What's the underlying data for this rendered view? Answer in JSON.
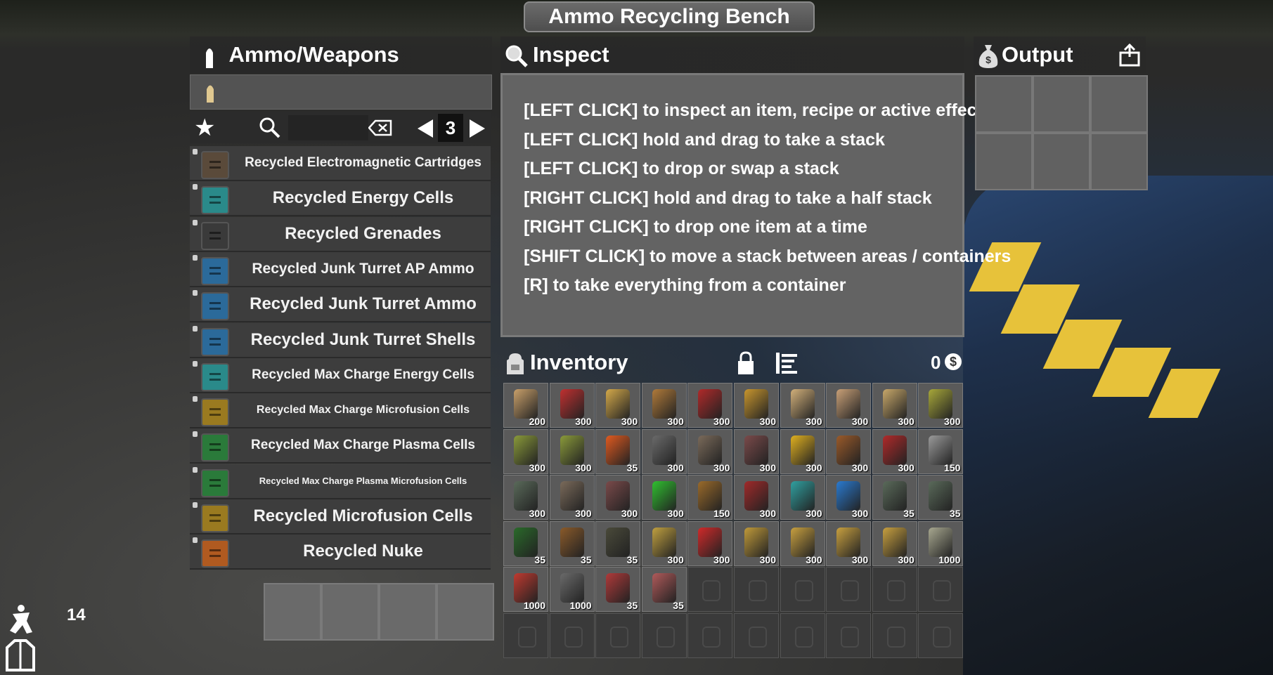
{
  "window_title": "Ammo Recycling Bench",
  "left_panel": {
    "title": "Ammo/Weapons",
    "page": "3",
    "recipes": [
      {
        "label": "Recycled Electromagnetic Cartridges",
        "color": "#5a4a3a",
        "size": 19
      },
      {
        "label": "Recycled Energy Cells",
        "color": "#2a8a8a",
        "size": 24
      },
      {
        "label": "Recycled Grenades",
        "color": "#3a3a3a",
        "size": 24
      },
      {
        "label": "Recycled Junk Turret AP Ammo",
        "color": "#2b6a9a",
        "size": 21
      },
      {
        "label": "Recycled Junk Turret Ammo",
        "color": "#2b6a9a",
        "size": 24
      },
      {
        "label": "Recycled Junk Turret Shells",
        "color": "#2b6a9a",
        "size": 24
      },
      {
        "label": "Recycled Max Charge Energy Cells",
        "color": "#2a8a8a",
        "size": 19
      },
      {
        "label": "Recycled Max Charge Microfusion Cells",
        "color": "#9a7a20",
        "size": 16
      },
      {
        "label": "Recycled Max Charge Plasma Cells",
        "color": "#2a7a3a",
        "size": 19
      },
      {
        "label": "Recycled Max Charge Plasma Microfusion Cells",
        "color": "#2a7a3a",
        "size": 13
      },
      {
        "label": "Recycled Microfusion Cells",
        "color": "#9a7a20",
        "size": 24
      },
      {
        "label": "Recycled Nuke",
        "color": "#b05a20",
        "size": 24
      }
    ]
  },
  "inspect": {
    "title": "Inspect",
    "lines": [
      "[LEFT CLICK] to inspect an item, recipe or active effect",
      "[LEFT CLICK] hold and drag to take a stack",
      "[LEFT CLICK] to drop or swap a stack",
      "[RIGHT CLICK] hold and drag to take a half stack",
      "[RIGHT CLICK] to drop one item at a time",
      "[SHIFT CLICK] to move a stack between areas / containers",
      "[R] to take everything from a container"
    ]
  },
  "output": {
    "title": "Output"
  },
  "inventory": {
    "title": "Inventory",
    "money": "0",
    "rows": [
      [
        {
          "c": "200",
          "col": "#c9a06a"
        },
        {
          "c": "300",
          "col": "#c03030"
        },
        {
          "c": "300",
          "col": "#d4a94a"
        },
        {
          "c": "300",
          "col": "#b07a3a"
        },
        {
          "c": "300",
          "col": "#b02a2a"
        },
        {
          "c": "300",
          "col": "#c8962e"
        },
        {
          "c": "300",
          "col": "#d2b07a"
        },
        {
          "c": "300",
          "col": "#c9a077"
        },
        {
          "c": "300",
          "col": "#c8a86a"
        },
        {
          "c": "300",
          "col": "#a8a83a"
        }
      ],
      [
        {
          "c": "300",
          "col": "#8a9a3a"
        },
        {
          "c": "300",
          "col": "#8a9a3a"
        },
        {
          "c": "35",
          "col": "#e05a20"
        },
        {
          "c": "300",
          "col": "#6a6a6a"
        },
        {
          "c": "300",
          "col": "#7a6a5a"
        },
        {
          "c": "300",
          "col": "#7a4a4a"
        },
        {
          "c": "300",
          "col": "#e0b020"
        },
        {
          "c": "300",
          "col": "#9a5a2a"
        },
        {
          "c": "300",
          "col": "#b02a2a"
        },
        {
          "c": "150",
          "col": "#9a9a9a"
        }
      ],
      [
        {
          "c": "300",
          "col": "#5a6a5a"
        },
        {
          "c": "300",
          "col": "#7a6a5a"
        },
        {
          "c": "300",
          "col": "#7a4a4a"
        },
        {
          "c": "300",
          "col": "#30c030"
        },
        {
          "c": "150",
          "col": "#9a6a2a"
        },
        {
          "c": "300",
          "col": "#a02a2a"
        },
        {
          "c": "300",
          "col": "#30a0a0"
        },
        {
          "c": "300",
          "col": "#2a7ad0"
        },
        {
          "c": "35",
          "col": "#5a6a5a"
        },
        {
          "c": "35",
          "col": "#5a6a5a"
        }
      ],
      [
        {
          "c": "35",
          "col": "#2a6a2a"
        },
        {
          "c": "35",
          "col": "#8a5a2a"
        },
        {
          "c": "35",
          "col": "#4a4a3a"
        },
        {
          "c": "300",
          "col": "#c0a040"
        },
        {
          "c": "300",
          "col": "#d02a2a"
        },
        {
          "c": "300",
          "col": "#c09a3a"
        },
        {
          "c": "300",
          "col": "#c8a040"
        },
        {
          "c": "300",
          "col": "#c8a040"
        },
        {
          "c": "300",
          "col": "#c8a040"
        },
        {
          "c": "1000",
          "col": "#a8a890"
        }
      ],
      [
        {
          "c": "1000",
          "col": "#c03a30"
        },
        {
          "c": "1000",
          "col": "#6a6a6a"
        },
        {
          "c": "35",
          "col": "#b03a3a"
        },
        {
          "c": "35",
          "col": "#b05a5a"
        },
        {
          "c": "",
          "col": ""
        },
        {
          "c": "",
          "col": ""
        },
        {
          "c": "",
          "col": ""
        },
        {
          "c": "",
          "col": ""
        },
        {
          "c": "",
          "col": ""
        },
        {
          "c": "",
          "col": ""
        }
      ],
      [
        {
          "c": "",
          "col": ""
        },
        {
          "c": "",
          "col": ""
        },
        {
          "c": "",
          "col": ""
        },
        {
          "c": "",
          "col": ""
        },
        {
          "c": "",
          "col": ""
        },
        {
          "c": "",
          "col": ""
        },
        {
          "c": "",
          "col": ""
        },
        {
          "c": "",
          "col": ""
        },
        {
          "c": "",
          "col": ""
        },
        {
          "c": "",
          "col": ""
        }
      ]
    ]
  },
  "hud": {
    "level": "14"
  }
}
